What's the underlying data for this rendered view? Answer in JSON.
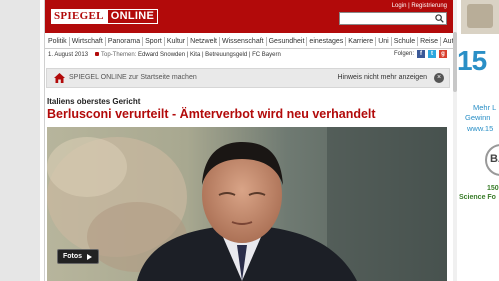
{
  "header": {
    "logo_left": "SPIEGEL",
    "logo_right": "ONLINE",
    "login": "Login",
    "register": "Registrierung",
    "link_sep": "|",
    "search_placeholder": ""
  },
  "nav": [
    "Politik",
    "Wirtschaft",
    "Panorama",
    "Sport",
    "Kultur",
    "Netzwelt",
    "Wissenschaft",
    "Gesundheit",
    "einestages",
    "Karriere",
    "Uni",
    "Schule",
    "Reise",
    "Auto"
  ],
  "subbar": {
    "date": "1. August 2013",
    "topics_label": "Top-Themen:",
    "topics": "Edward Snowden | Kita | Betreuungsgeld | FC Bayern",
    "follow_label": "Folgen:",
    "follow_icons": [
      "facebook-icon",
      "twitter-icon",
      "google-plus-icon"
    ],
    "follow_glyphs": [
      "f",
      "t",
      "g"
    ]
  },
  "startpage_bar": {
    "text": "SPIEGEL ONLINE zur Startseite machen",
    "hint": "Hinweis nicht mehr anzeigen",
    "close": "×"
  },
  "article": {
    "kicker": "Italiens oberstes Gericht",
    "headline": "Berlusconi verurteilt - Ämterverbot wird neu verhandelt",
    "photo_button": "Fotos"
  },
  "ad": {
    "big": "15",
    "line1": "Mehr L",
    "line2": "Gewinn",
    "line3": "www.15",
    "logo": "BA",
    "line4": "150",
    "line5": "Science Fo"
  },
  "colors": {
    "brand": "#b20a0a",
    "ad_blue": "#2a8fc6",
    "ad_green": "#3a7d2a"
  }
}
